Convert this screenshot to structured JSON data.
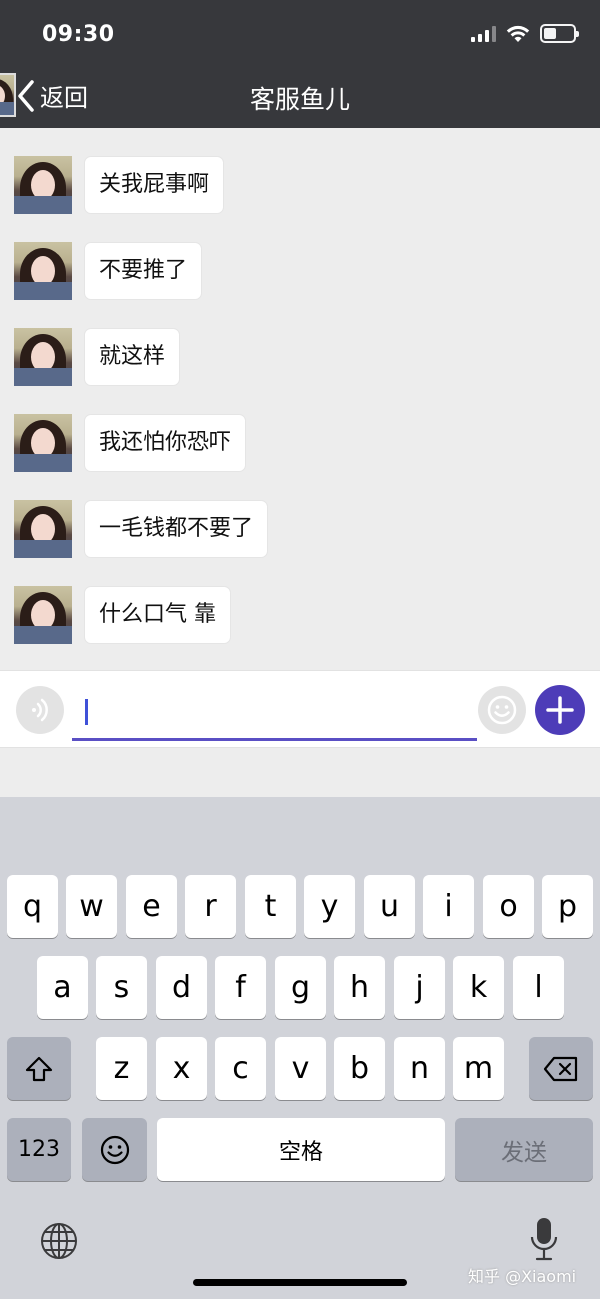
{
  "status_bar": {
    "time": "09:30"
  },
  "nav": {
    "back_label": "返回",
    "title": "客服鱼儿"
  },
  "messages": [
    {
      "text": "关我屁事啊"
    },
    {
      "text": "不要推了"
    },
    {
      "text": "就这样"
    },
    {
      "text": "我还怕你恐吓"
    },
    {
      "text": "一毛钱都不要了"
    },
    {
      "text": "什么口气  靠"
    }
  ],
  "input": {
    "value": ""
  },
  "keyboard": {
    "row1": [
      "q",
      "w",
      "e",
      "r",
      "t",
      "y",
      "u",
      "i",
      "o",
      "p"
    ],
    "row2": [
      "a",
      "s",
      "d",
      "f",
      "g",
      "h",
      "j",
      "k",
      "l"
    ],
    "row3": [
      "z",
      "x",
      "c",
      "v",
      "b",
      "n",
      "m"
    ],
    "numbers_label": "123",
    "space_label": "空格",
    "send_label": "发送"
  },
  "watermark": "知乎 @Xiaomi",
  "colors": {
    "header": "#37383c",
    "accent": "#4d3cb8",
    "background": "#ededed",
    "keyboard": "#d1d3d9"
  }
}
